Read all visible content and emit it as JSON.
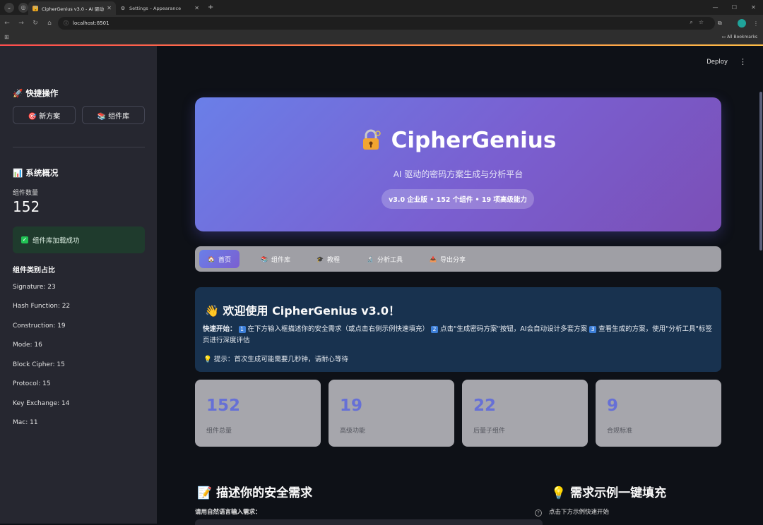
{
  "browser": {
    "tabs": [
      {
        "title": "CipherGenius v3.0 - AI 驱动方案",
        "active": true
      },
      {
        "title": "Settings – Appearance",
        "active": false
      }
    ],
    "url": "localhost:8501",
    "bookmarks_label": "All Bookmarks"
  },
  "app": {
    "deploy_label": "Deploy"
  },
  "sidebar": {
    "quick_title": "🚀 快捷操作",
    "new_plan": "🎯 新方案",
    "component_lib": "📚 组件库",
    "overview_title": "📊 系统概况",
    "component_count_label": "组件数量",
    "component_count": "152",
    "load_success": "组件库加载成功",
    "category_title": "组件类别占比",
    "categories": [
      "Signature: 23",
      "Hash Function: 22",
      "Construction: 19",
      "Mode: 16",
      "Block Cipher: 15",
      "Protocol: 15",
      "Key Exchange: 14",
      "Mac: 11"
    ]
  },
  "hero": {
    "title": "CipherGenius",
    "subtitle": "AI 驱动的密码方案生成与分析平台",
    "badge": "v3.0 企业版 • 152 个组件 • 19 项高级能力"
  },
  "nav_tabs": [
    {
      "icon": "🏠",
      "label": "首页"
    },
    {
      "icon": "📚",
      "label": "组件库"
    },
    {
      "icon": "🎓",
      "label": "教程"
    },
    {
      "icon": "🔬",
      "label": "分析工具"
    },
    {
      "icon": "📤",
      "label": "导出分享"
    }
  ],
  "welcome": {
    "title": "👋 欢迎使用 CipherGenius v3.0！",
    "quick_start_label": "快速开始：",
    "step1_num": "1",
    "step1": "在下方输入框描述你的安全需求（或点击右侧示例快速填充）",
    "step2_num": "2",
    "step2": "点击\"生成密码方案\"按钮，AI会自动设计多套方案",
    "step3_num": "3",
    "step3": "查看生成的方案，使用\"分析工具\"标签页进行深度评估",
    "tip": "💡 提示：首次生成可能需要几秒钟，请耐心等待"
  },
  "stats": [
    {
      "value": "152",
      "label": "组件总量"
    },
    {
      "value": "19",
      "label": "高级功能"
    },
    {
      "value": "22",
      "label": "后量子组件"
    },
    {
      "value": "9",
      "label": "合规标准"
    }
  ],
  "requirements": {
    "title": "📝 描述你的安全需求",
    "input_label": "请用自然语言输入需求："
  },
  "examples": {
    "title": "💡 需求示例一键填充",
    "hint": "点击下方示例快速开始"
  }
}
